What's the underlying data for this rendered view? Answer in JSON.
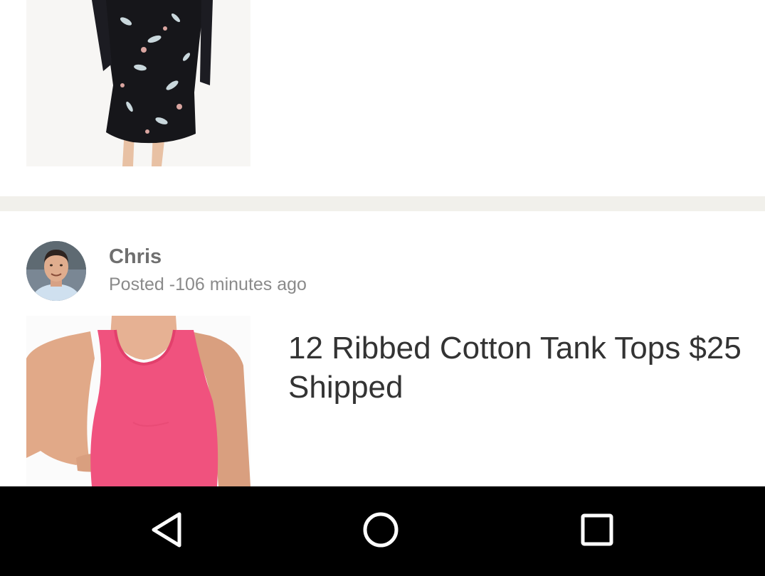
{
  "feed": {
    "previous_post": {
      "thumbnail_icon": "floral-dress-photo"
    },
    "post": {
      "author": "Chris",
      "posted_time": "Posted -106 minutes ago",
      "avatar_icon": "man-portrait-avatar",
      "thumbnail_icon": "pink-tank-top-photo",
      "title": "12 Ribbed Cotton Tank Tops $25 Shipped"
    }
  },
  "navbar": {
    "back_icon": "back-triangle-icon",
    "home_icon": "home-circle-icon",
    "recents_icon": "recents-square-icon"
  },
  "colors": {
    "divider": "#f1f0eb",
    "navbar_bg": "#000000",
    "title_text": "#333333",
    "meta_text": "#8a8a8a"
  }
}
